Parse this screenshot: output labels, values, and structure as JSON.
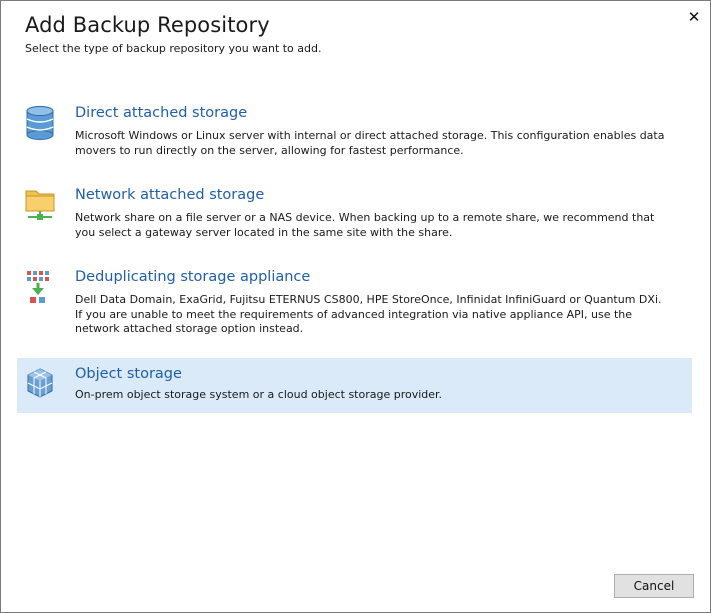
{
  "dialog": {
    "title": "Add Backup Repository",
    "subtitle": "Select the type of backup repository you want to add.",
    "close_icon": "close-icon"
  },
  "options": [
    {
      "title": "Direct attached storage",
      "description": "Microsoft Windows or Linux server with internal or direct attached storage. This configuration enables data movers to run directly on the server, allowing for fastest performance.",
      "icon": "database-icon",
      "selected": false
    },
    {
      "title": "Network attached storage",
      "description": "Network share on a file server or a NAS device. When backing up to a remote share, we recommend that you select a gateway server located in the same site with the share.",
      "icon": "network-folder-icon",
      "selected": false
    },
    {
      "title": "Deduplicating storage appliance",
      "description": "Dell Data Domain, ExaGrid, Fujitsu ETERNUS CS800, HPE StoreOnce, Infinidat InfiniGuard or Quantum DXi. If you are unable to meet the requirements of advanced integration via native appliance API, use the network attached storage option instead.",
      "icon": "deduplication-icon",
      "selected": false
    },
    {
      "title": "Object storage",
      "description": "On-prem object storage system or a cloud object storage provider.",
      "icon": "object-storage-icon",
      "selected": true
    }
  ],
  "footer": {
    "cancel_label": "Cancel"
  },
  "colors": {
    "link_blue": "#1f5fa8",
    "selection_bg": "#daeaf8"
  }
}
